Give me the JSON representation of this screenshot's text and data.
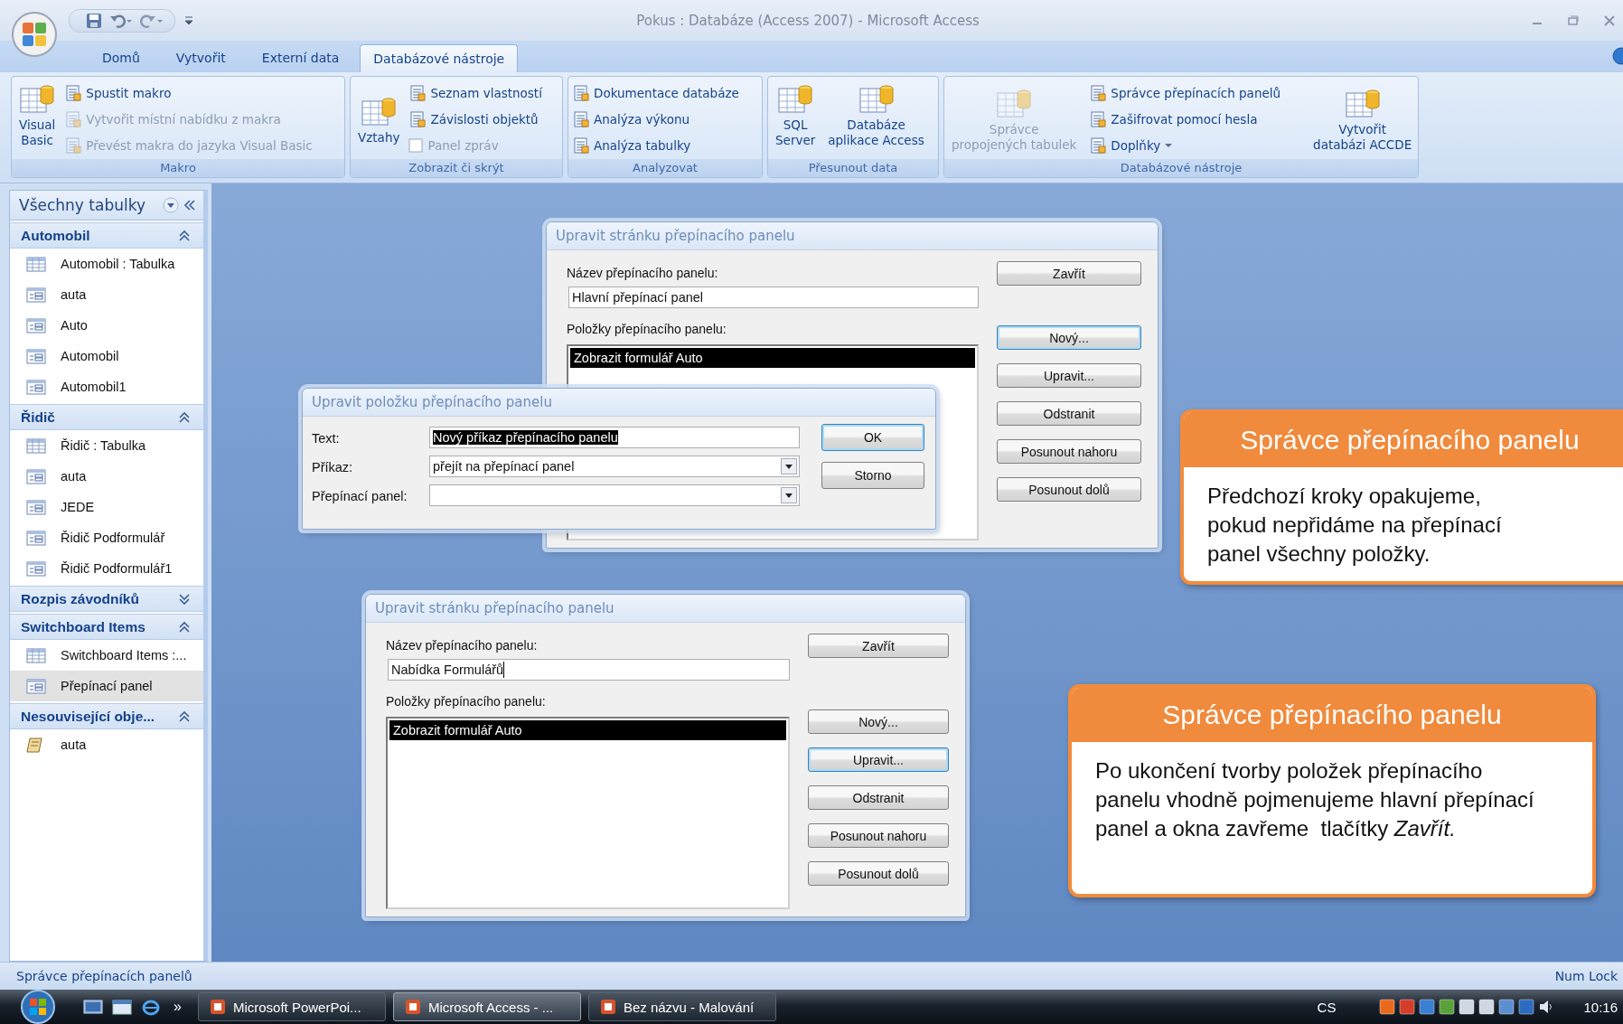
{
  "window": {
    "title": "Pokus : Databáze (Access 2007) - Microsoft Access"
  },
  "tabs": [
    {
      "label": "Domů",
      "selected": false
    },
    {
      "label": "Vytvořit",
      "selected": false
    },
    {
      "label": "Externí data",
      "selected": false
    },
    {
      "label": "Databázové nástroje",
      "selected": true
    }
  ],
  "ribbon": {
    "groups": [
      {
        "label": "Makro",
        "items": [
          {
            "kind": "large",
            "label": "Visual\nBasic",
            "disabled": false
          },
          {
            "kind": "small",
            "label": "Spustit makro",
            "disabled": false
          },
          {
            "kind": "small",
            "label": "Vytvořit místní nabídku z makra",
            "disabled": true
          },
          {
            "kind": "small",
            "label": "Převést makra do jazyka Visual Basic",
            "disabled": true
          }
        ]
      },
      {
        "label": "Zobrazit či skrýt",
        "items": [
          {
            "kind": "large",
            "label": "Vztahy",
            "disabled": false
          },
          {
            "kind": "small",
            "label": "Seznam vlastností",
            "disabled": false
          },
          {
            "kind": "small",
            "label": "Závislosti objektů",
            "disabled": false
          },
          {
            "kind": "checkbox",
            "label": "Panel zpráv",
            "disabled": true,
            "checked": false
          }
        ]
      },
      {
        "label": "Analyzovat",
        "items": [
          {
            "kind": "small",
            "label": "Dokumentace databáze",
            "disabled": false
          },
          {
            "kind": "small",
            "label": "Analýza výkonu",
            "disabled": false
          },
          {
            "kind": "small",
            "label": "Analýza tabulky",
            "disabled": false
          }
        ]
      },
      {
        "label": "Přesunout data",
        "items": [
          {
            "kind": "large",
            "label": "SQL\nServer",
            "disabled": false
          },
          {
            "kind": "large",
            "label": "Databáze\naplikace Access",
            "disabled": false
          }
        ]
      },
      {
        "label": "Databázové nástroje",
        "items": [
          {
            "kind": "large",
            "label": "Správce\npropojených tabulek",
            "disabled": true
          },
          {
            "kind": "small",
            "label": "Správce přepínacích panelů",
            "disabled": false
          },
          {
            "kind": "small",
            "label": "Zašifrovat pomocí hesla",
            "disabled": false
          },
          {
            "kind": "small",
            "label": "Doplňky",
            "disabled": false,
            "dropdown": true
          },
          {
            "kind": "large",
            "label": "Vytvořit\ndatabázi ACCDE",
            "disabled": false
          }
        ]
      }
    ]
  },
  "sidebar": {
    "title": "Všechny tabulky",
    "groups": [
      {
        "title": "Automobil",
        "expanded": true,
        "items": [
          {
            "kind": "table",
            "label": "Automobil : Tabulka",
            "selected": false
          },
          {
            "kind": "form",
            "label": "auta",
            "selected": false
          },
          {
            "kind": "form",
            "label": "Auto",
            "selected": false
          },
          {
            "kind": "form",
            "label": "Automobil",
            "selected": false
          },
          {
            "kind": "form",
            "label": "Automobil1",
            "selected": false
          }
        ]
      },
      {
        "title": "Řidič",
        "expanded": true,
        "items": [
          {
            "kind": "table",
            "label": "Řidič : Tabulka",
            "selected": false
          },
          {
            "kind": "form",
            "label": "auta",
            "selected": false
          },
          {
            "kind": "form",
            "label": "JEDE",
            "selected": false
          },
          {
            "kind": "form",
            "label": "Řidič Podformulář",
            "selected": false
          },
          {
            "kind": "form",
            "label": "Řidič Podformulář1",
            "selected": false
          }
        ]
      },
      {
        "title": "Rozpis závodníků",
        "expanded": false
      },
      {
        "title": "Switchboard Items",
        "expanded": true,
        "items": [
          {
            "kind": "table",
            "label": "Switchboard Items :...",
            "selected": false
          },
          {
            "kind": "form",
            "label": "Přepínací panel",
            "selected": true
          }
        ]
      },
      {
        "title": "Nesouvisející obje...",
        "expanded": true,
        "items": [
          {
            "kind": "macro",
            "label": "auta",
            "selected": false
          }
        ]
      }
    ]
  },
  "dialogs": [
    {
      "kind": "page",
      "title": "Upravit stránku přepínacího panelu",
      "name_label": "Název přepínacího panelu:",
      "name_value": "Hlavní přepínací panel",
      "name_caret": false,
      "items_label": "Položky přepínacího panelu:",
      "list_items": [
        {
          "text": "Zobrazit formulář Auto",
          "selected": true
        }
      ],
      "buttons": [
        {
          "label": "Zavřít",
          "focused": false
        },
        {
          "label": "Nový...",
          "focused": true
        },
        {
          "label": "Upravit...",
          "focused": false
        },
        {
          "label": "Odstranit",
          "focused": false
        },
        {
          "label": "Posunout nahoru",
          "focused": false
        },
        {
          "label": "Posunout dolů",
          "focused": false
        }
      ]
    },
    {
      "kind": "item",
      "title": "Upravit položku přepínacího panelu",
      "fields": [
        {
          "kind": "text",
          "label": "Text:",
          "value": "Nový příkaz přepínacího panelu",
          "highlighted": true
        },
        {
          "kind": "select",
          "label": "Příkaz:",
          "value": "přejít na přepínací panel"
        },
        {
          "kind": "select",
          "label": "Přepínací panel:"
        }
      ],
      "buttons": [
        {
          "label": "OK",
          "focused": true
        },
        {
          "label": "Storno",
          "focused": false
        }
      ]
    },
    {
      "kind": "page",
      "title": "Upravit stránku přepínacího panelu",
      "name_label": "Název přepínacího panelu:",
      "name_value": "Nabídka Formulářů",
      "name_caret": true,
      "items_label": "Položky přepínacího panelu:",
      "list_items": [
        {
          "text": "Zobrazit formulář Auto",
          "selected": true
        }
      ],
      "buttons": [
        {
          "label": "Zavřít",
          "focused": false
        },
        {
          "label": "Nový...",
          "focused": false
        },
        {
          "label": "Upravit...",
          "focused": true
        },
        {
          "label": "Odstranit",
          "focused": false
        },
        {
          "label": "Posunout nahoru",
          "focused": false
        },
        {
          "label": "Posunout dolů",
          "focused": false
        }
      ]
    }
  ],
  "callouts": [
    {
      "title": "Správce přepínacího panelu",
      "body": "Předchozí kroky opakujeme, pokud nepřidáme na přepínací panel všechny položky."
    },
    {
      "title": "Správce přepínacího panelu",
      "body": "Po ukončení tvorby položek přepínacího panelu vhodně pojmenujeme hlavní přepínací panel a okna zavřeme  tlačítky *Zavřít.*"
    }
  ],
  "status_bar": {
    "text": "Správce přepínacích panelů",
    "indicator": "Num Lock"
  },
  "taskbar": {
    "overflow": "»",
    "tasks": [
      {
        "label": "Microsoft PowerPoi...",
        "selected": false
      },
      {
        "label": "Microsoft Access - ...",
        "selected": true
      },
      {
        "label": "Bez názvu - Malování",
        "selected": false
      }
    ],
    "language": "CS",
    "clock": "10:16"
  }
}
